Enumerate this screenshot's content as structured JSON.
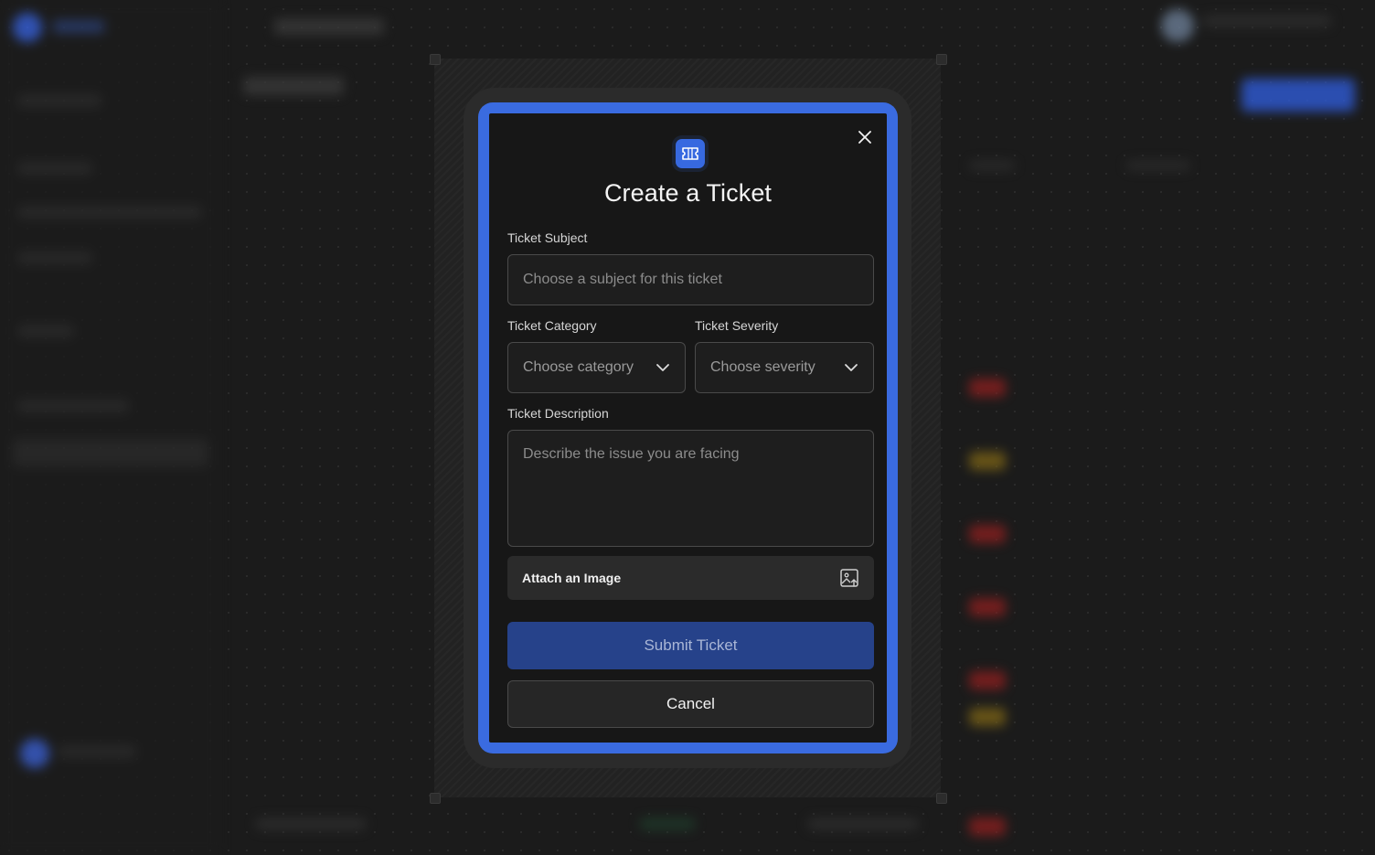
{
  "modal": {
    "title": "Create a Ticket",
    "close_icon": "close-icon",
    "header_icon": "ticket-icon",
    "subject": {
      "label": "Ticket Subject",
      "placeholder": "Choose a subject for this ticket"
    },
    "category": {
      "label": "Ticket Category",
      "value": "Choose category"
    },
    "severity": {
      "label": "Ticket Severity",
      "value": "Choose severity"
    },
    "description": {
      "label": "Ticket Description",
      "placeholder": "Describe the issue you are facing"
    },
    "attach": {
      "label": "Attach an Image",
      "icon": "image-upload-icon"
    },
    "submit_label": "Submit Ticket",
    "cancel_label": "Cancel"
  },
  "colors": {
    "accent": "#3a6be0",
    "submit_bg": "#26428a",
    "modal_bg": "#171717"
  }
}
